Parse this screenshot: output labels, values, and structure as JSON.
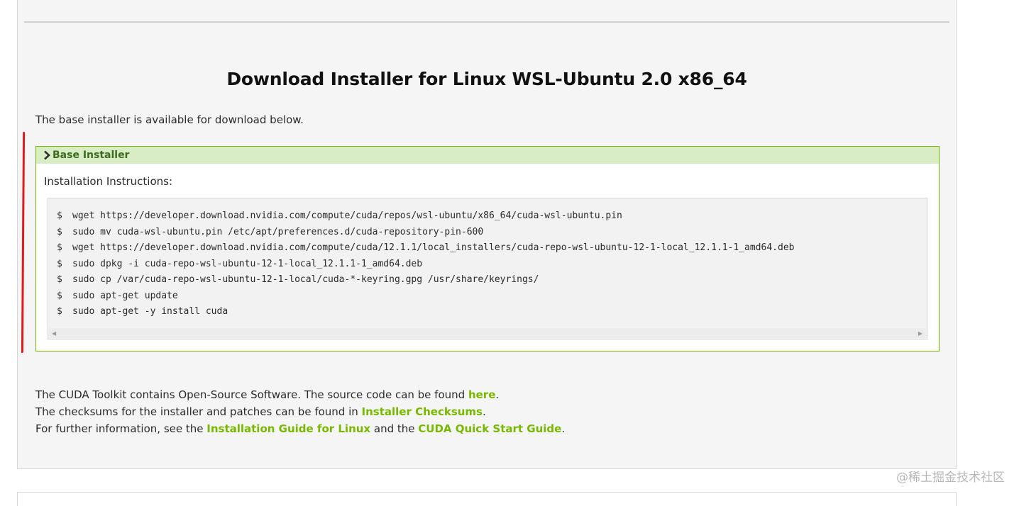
{
  "page": {
    "title": "Download Installer for Linux WSL-Ubuntu 2.0 x86_64",
    "intro": "The base installer is available for download below."
  },
  "installer": {
    "header": "Base Installer",
    "instructions_label": "Installation Instructions:",
    "prompt": "$",
    "commands": [
      "wget https://developer.download.nvidia.com/compute/cuda/repos/wsl-ubuntu/x86_64/cuda-wsl-ubuntu.pin",
      "sudo mv cuda-wsl-ubuntu.pin /etc/apt/preferences.d/cuda-repository-pin-600",
      "wget https://developer.download.nvidia.com/compute/cuda/12.1.1/local_installers/cuda-repo-wsl-ubuntu-12-1-local_12.1.1-1_amd64.deb",
      "sudo dpkg -i cuda-repo-wsl-ubuntu-12-1-local_12.1.1-1_amd64.deb",
      "sudo cp /var/cuda-repo-wsl-ubuntu-12-1-local/cuda-*-keyring.gpg /usr/share/keyrings/",
      "sudo apt-get update",
      "sudo apt-get -y install cuda"
    ]
  },
  "footer": {
    "line1_text": "The CUDA Toolkit contains Open-Source Software. The source code can be found ",
    "line1_link": "here",
    "line1_end": ".",
    "line2_text": "The checksums for the installer and patches can be found in ",
    "line2_link": "Installer Checksums",
    "line2_end": ".",
    "line3_text": "For further information, see the ",
    "line3_link1": "Installation Guide for Linux",
    "line3_mid": " and the ",
    "line3_link2": "CUDA Quick Start Guide",
    "line3_end": "."
  },
  "watermark": "@稀土掘金技术社区",
  "colors": {
    "accent": "#76b900",
    "header_bg": "#d8ecc5",
    "annotation": "#e01b1b"
  }
}
